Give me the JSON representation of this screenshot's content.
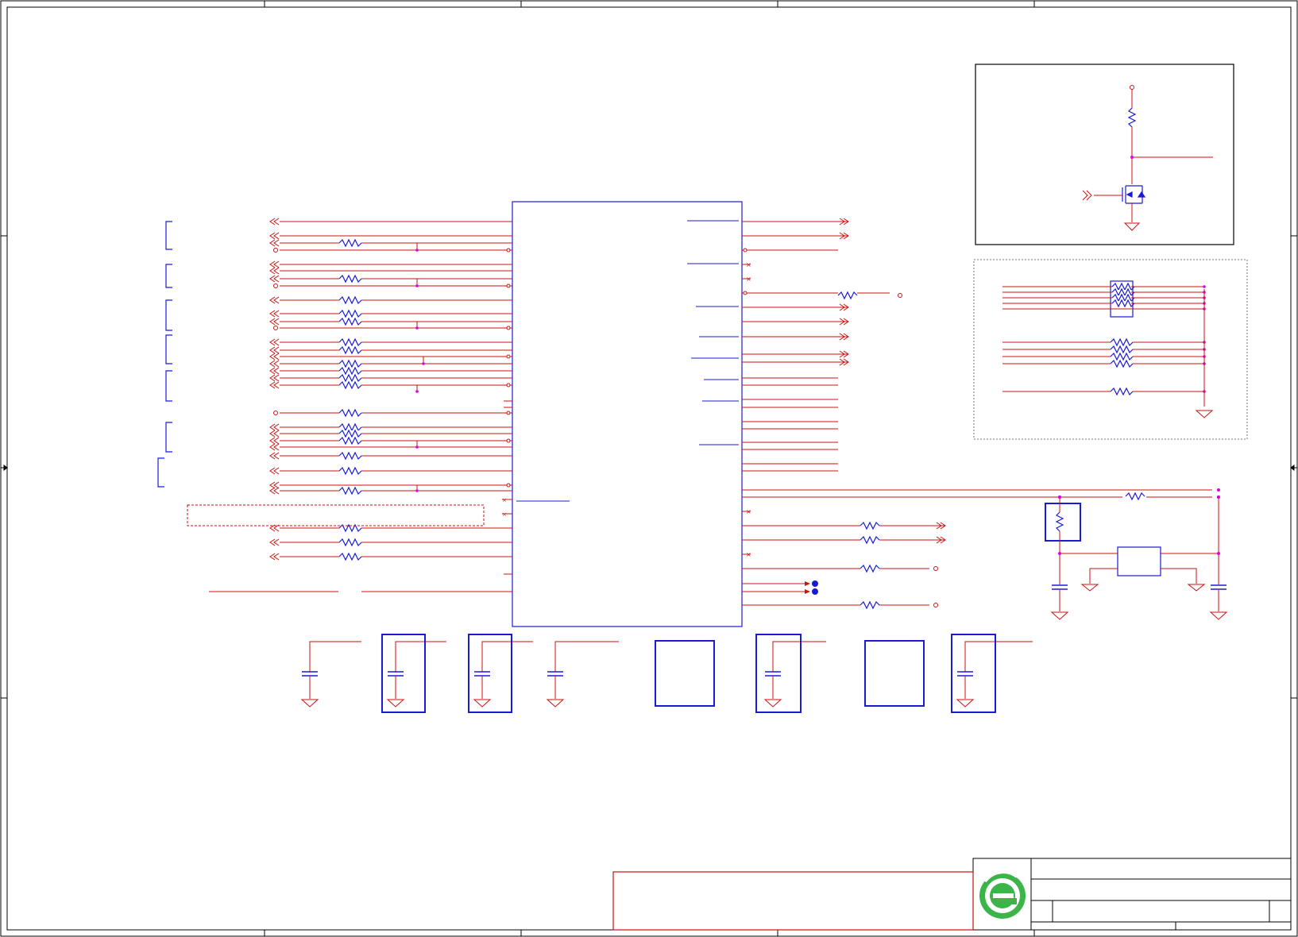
{
  "document": {
    "type": "schematic-sheet",
    "colors": {
      "wire": "#cc1111",
      "component": "#1a1ad6",
      "junction": "#dd00dd",
      "frame": "#000000",
      "logo_green": "#3bb54a"
    },
    "logo": {
      "icon": "e-logo-icon"
    }
  }
}
